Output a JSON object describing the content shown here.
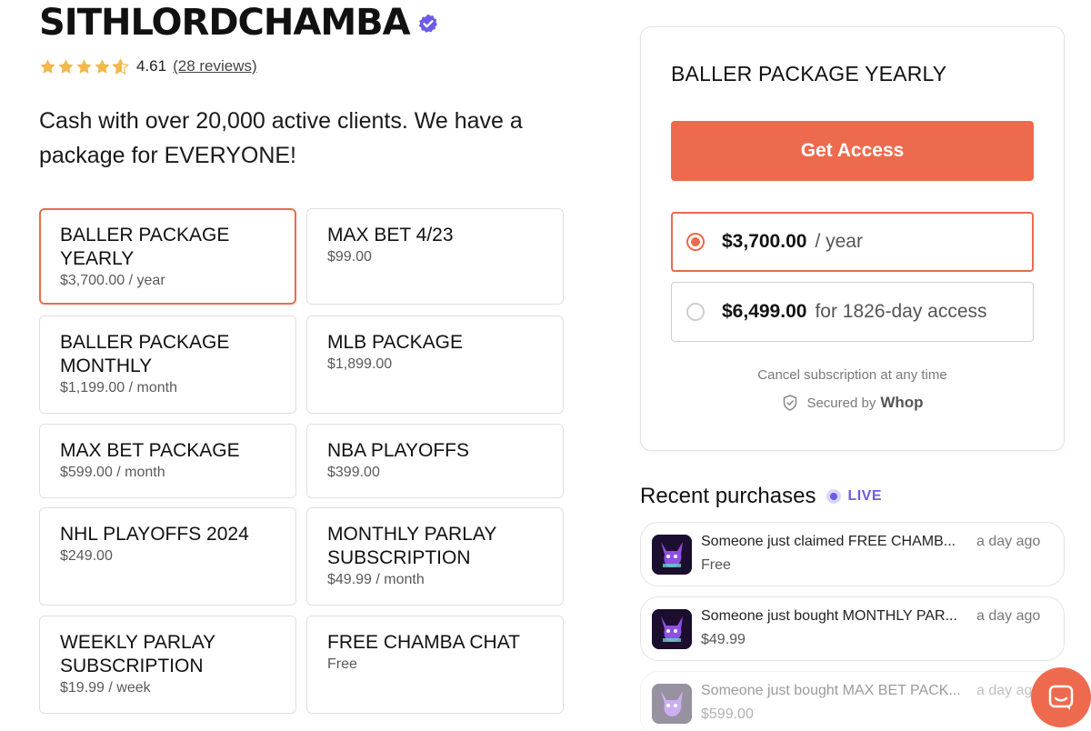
{
  "store": {
    "name": "SITHLORDCHAMBA",
    "rating": "4.61",
    "reviews_link": "(28 reviews)",
    "description": "Cash with over 20,000 active clients. We have a package for EVERYONE!"
  },
  "products": [
    {
      "name": "BALLER PACKAGE YEARLY",
      "price": "$3,700.00 / year",
      "selected": true
    },
    {
      "name": "MAX BET 4/23",
      "price": "$99.00",
      "selected": false
    },
    {
      "name": "BALLER PACKAGE MONTHLY",
      "price": "$1,199.00 / month",
      "selected": false
    },
    {
      "name": "MLB PACKAGE",
      "price": "$1,899.00",
      "selected": false
    },
    {
      "name": "MAX BET PACKAGE",
      "price": "$599.00 / month",
      "selected": false
    },
    {
      "name": "NBA PLAYOFFS",
      "price": "$399.00",
      "selected": false
    },
    {
      "name": "NHL PLAYOFFS 2024",
      "price": "$249.00",
      "selected": false
    },
    {
      "name": "MONTHLY PARLAY SUBSCRIPTION",
      "price": "$49.99 / month",
      "selected": false
    },
    {
      "name": "WEEKLY PARLAY SUBSCRIPTION",
      "price": "$19.99 / week",
      "selected": false
    },
    {
      "name": "FREE CHAMBA CHAT",
      "price": "Free",
      "selected": false
    }
  ],
  "checkout": {
    "title": "BALLER PACKAGE YEARLY",
    "button_label": "Get Access",
    "options": [
      {
        "amount": "$3,700.00",
        "period": "/ year",
        "selected": true
      },
      {
        "amount": "$6,499.00",
        "period": "for 1826-day access",
        "selected": false
      }
    ],
    "cancel_note": "Cancel subscription at any time",
    "secured_label": "Secured by",
    "secured_brand": "Whop"
  },
  "recent": {
    "title": "Recent purchases",
    "live_label": "LIVE",
    "items": [
      {
        "text": "Someone just claimed FREE CHAMB...",
        "time": "a day ago",
        "price": "Free"
      },
      {
        "text": "Someone just bought MONTHLY PAR...",
        "time": "a day ago",
        "price": "$49.99"
      },
      {
        "text": "Someone just bought MAX BET PACK...",
        "time": "a day ago",
        "price": "$599.00"
      }
    ]
  },
  "colors": {
    "accent": "#ee6a4f",
    "live": "#6c5ce7",
    "verified": "#6c5ce7",
    "star": "#f2b84b"
  },
  "icons": {
    "verified": "verified-badge-icon",
    "star": "star-icon",
    "shield": "shield-check-icon",
    "chat": "chat-bubble-icon"
  }
}
